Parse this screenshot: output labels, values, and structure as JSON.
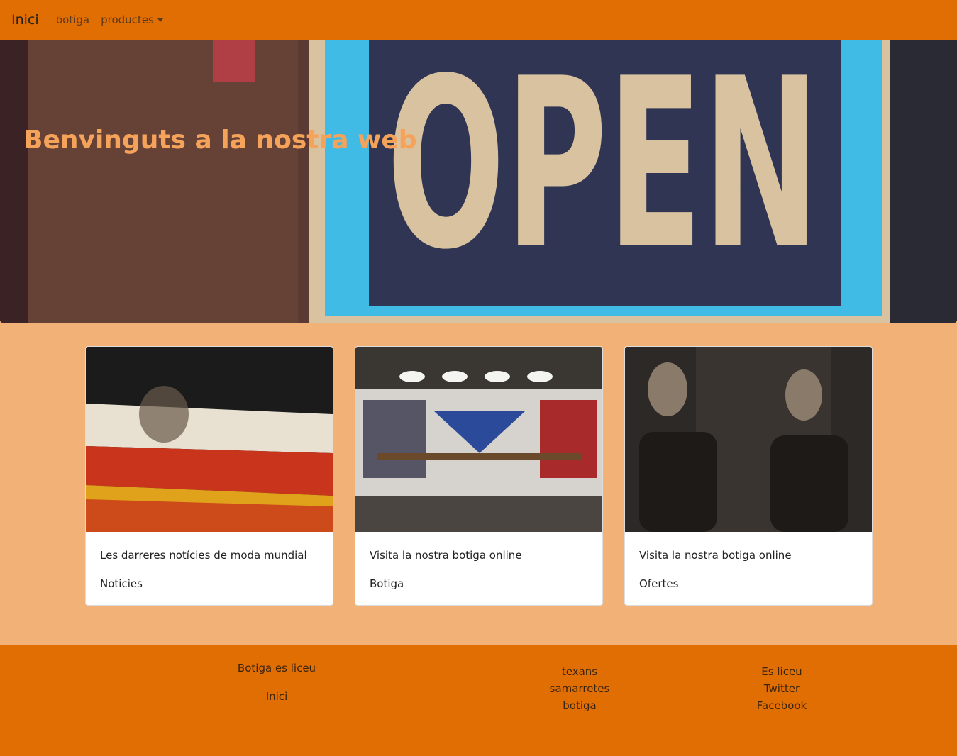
{
  "nav": {
    "brand": "Inici",
    "links": [
      "botiga",
      "productes"
    ]
  },
  "hero": {
    "title": "Benvinguts a la nostra web",
    "sign_text": "OPEN"
  },
  "cards": [
    {
      "text": "Les darreres notícies de moda mundial",
      "link": "Noticies",
      "image": "vogue-magazines"
    },
    {
      "text": "Visita la nostra botiga online",
      "link": "Botiga",
      "image": "clothing-store"
    },
    {
      "text": "Visita la nostra botiga online",
      "link": "Ofertes",
      "image": "sale-mannequins"
    }
  ],
  "footer": {
    "col1": {
      "title": "Botiga es liceu",
      "link": "Inici"
    },
    "col2": [
      "texans",
      "samarretes",
      "botiga"
    ],
    "col3": [
      "Es liceu",
      "Twitter",
      "Facebook"
    ]
  },
  "colors": {
    "primary": "#e16e02",
    "background": "#f2b277",
    "hero_title": "#f5a25a"
  }
}
